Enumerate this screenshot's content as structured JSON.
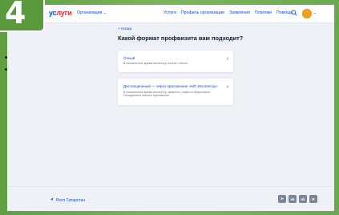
{
  "badge": {
    "number": "4"
  },
  "header": {
    "logo_main": "ус",
    "logo_accent": "луги",
    "org_menu": "Организации ⌄",
    "nav": [
      "Услуги",
      "Профиль организации",
      "Заявления",
      "Платежи",
      "Помощь"
    ],
    "chevron": "⌄"
  },
  "main": {
    "back": "< Назад",
    "title": "Какой формат профвизита вам подходит?",
    "options": [
      {
        "title": "Очный",
        "desc": "В назначенное время инспектор посетит объект",
        "arrow": "›"
      },
      {
        "title": "Дистанционный — через приложение «МП Инспектор»",
        "desc": "В назначенное время инспектор свяжется с вами по видеосвязи. Понадобится скачать приложение",
        "arrow": "›"
      }
    ]
  },
  "footer": {
    "region": "Респ Татарстан",
    "socials": [
      {
        "icon": "telegram-icon",
        "glyph": "➤"
      },
      {
        "icon": "vk-icon",
        "glyph": "vk"
      },
      {
        "icon": "ok-icon",
        "glyph": "ok"
      },
      {
        "icon": "rutube-icon",
        "glyph": "R"
      }
    ]
  },
  "colors": {
    "accent": "#0d4cd3",
    "logo_red": "#e8262c",
    "frame_green": "#6aa84f",
    "avatar": "#f0a21c"
  }
}
